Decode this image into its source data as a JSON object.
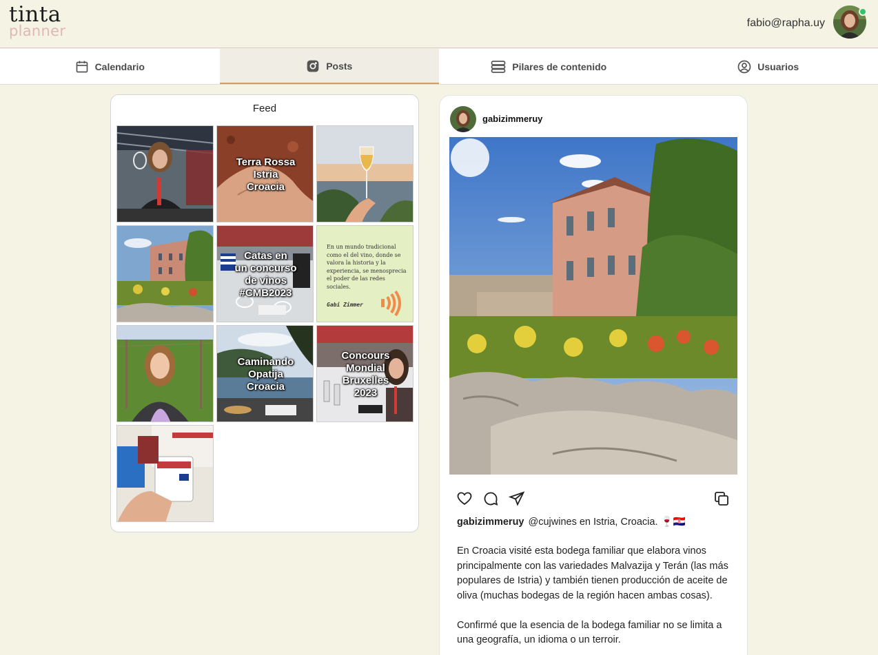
{
  "brand": {
    "name_top": "tinta",
    "name_bottom": "planner"
  },
  "user": {
    "email": "fabio@rapha.uy",
    "status": "online"
  },
  "tabs": [
    {
      "label": "Calendario",
      "icon": "calendar-icon",
      "active": false
    },
    {
      "label": "Posts",
      "icon": "instagram-icon",
      "active": true
    },
    {
      "label": "Pilares de contenido",
      "icon": "stack-icon",
      "active": false
    },
    {
      "label": "Usuarios",
      "icon": "user-circle-icon",
      "active": false
    }
  ],
  "feed": {
    "title": "Feed",
    "tiles": [
      {
        "overlay": "",
        "kind": "photo"
      },
      {
        "overlay": "Terra Rossa\nIstria\nCroacia",
        "kind": "photo"
      },
      {
        "overlay": "",
        "kind": "photo"
      },
      {
        "overlay": "",
        "kind": "photo"
      },
      {
        "overlay": "Catas en\nun concurso\nde vinos\n#CMB2023",
        "kind": "photo"
      },
      {
        "overlay": "",
        "kind": "quote",
        "quote": "En un mundo tradicional como el del vino, donde se valora la historia y la experiencia, se menosprecia el poder de las redes sociales.",
        "author": "Gabi Zimmer"
      },
      {
        "overlay": "",
        "kind": "photo"
      },
      {
        "overlay": "Caminando\nOpatija\nCroacia",
        "kind": "photo"
      },
      {
        "overlay": "Concours\nMondial\nBruxelles\n2023",
        "kind": "photo"
      },
      {
        "overlay": "",
        "kind": "photo"
      }
    ]
  },
  "post": {
    "username": "gabizimmeruy",
    "caption_user": "gabizimmeruy",
    "caption_first": "@cujwines en Istria, Croacia. 🍷🇭🇷",
    "paragraphs": [
      "En Croacia visité esta bodega familiar que elabora vinos principalmente con las variedades Malvazija y Terán (las más populares de Istria) y también tienen producción de aceite de oliva (muchas bodegas de la región hacen ambas cosas).",
      "Confirmé que la esencia de la bodega familiar no se limita a una geografía, un idioma o un terroir."
    ]
  },
  "colors": {
    "background": "#f5f3e4",
    "accent": "#c9a06a",
    "logo_pink": "#e0b8b3",
    "online": "#2fc46b"
  }
}
